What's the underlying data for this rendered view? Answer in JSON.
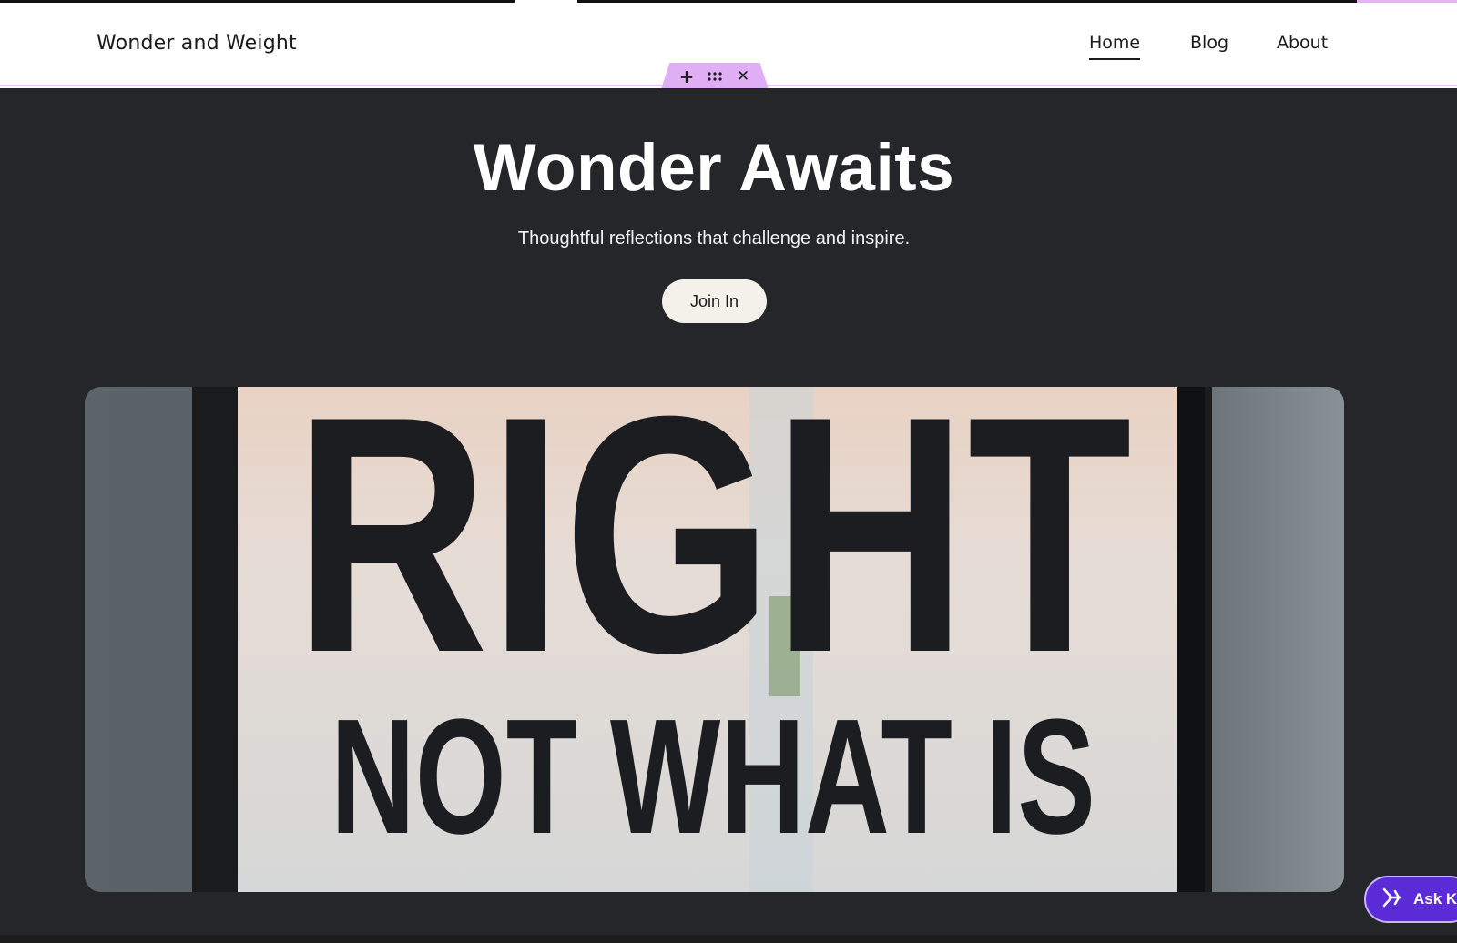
{
  "header": {
    "site_title": "Wonder and Weight",
    "nav": [
      {
        "label": "Home",
        "active": true
      },
      {
        "label": "Blog",
        "active": false
      },
      {
        "label": "About",
        "active": false
      }
    ]
  },
  "edit_toolbar": {
    "add_icon": "plus-icon",
    "move_icon": "drag-dots-icon",
    "close_icon": "close-icon",
    "accent_color": "#dfaef5"
  },
  "hero": {
    "title": "Wonder Awaits",
    "subtitle": "Thoughtful reflections that challenge and inspire.",
    "cta_label": "Join In",
    "background_color": "#252629",
    "image_text_line1": "RIGHT",
    "image_text_line2": "NOT WHAT IS"
  },
  "ask_widget": {
    "label": "Ask Ko",
    "icon": "sparkle-icon",
    "color": "#5b2bd8"
  }
}
